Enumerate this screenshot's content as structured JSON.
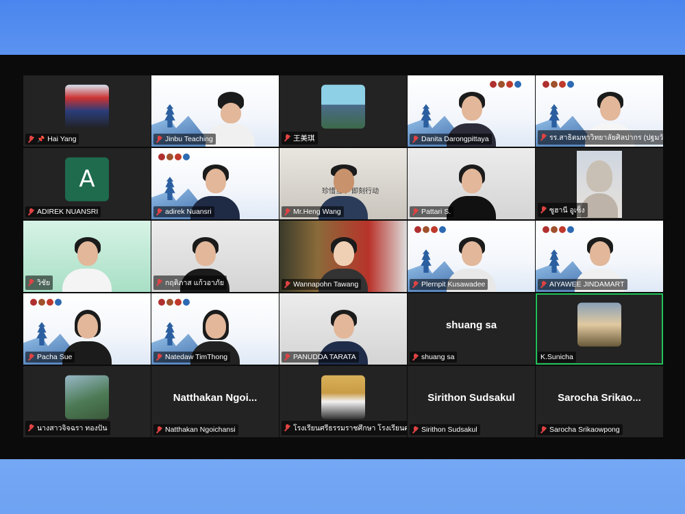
{
  "participants": [
    {
      "label": "Hai Yang",
      "muted": true,
      "pinned": true,
      "kind": "avatar"
    },
    {
      "label": "Jinbu Teaching",
      "muted": true,
      "kind": "slide"
    },
    {
      "label": "王美琪",
      "muted": true,
      "kind": "avatar"
    },
    {
      "label": "Danita Darongpittaya",
      "muted": true,
      "kind": "slide"
    },
    {
      "label": "รร.สาธิตมหาวิทยาลัยศิลปากร (ปฐมวัยและป...",
      "muted": true,
      "kind": "slide"
    },
    {
      "label": "ADIREK NUANSRI",
      "muted": true,
      "kind": "letter",
      "letter": "A"
    },
    {
      "label": "adirek Nuansri",
      "muted": true,
      "kind": "slide"
    },
    {
      "label": "Mr.Heng Wang",
      "muted": true,
      "kind": "video",
      "caption": "珍惜当下 即刻行动"
    },
    {
      "label": "Pattari S.",
      "muted": true,
      "kind": "video"
    },
    {
      "label": "ซูฮานี อูเซ็ง",
      "muted": true,
      "kind": "video"
    },
    {
      "label": "วิชัย",
      "muted": true,
      "kind": "video"
    },
    {
      "label": "กฤติภาส แก้วอาภัย",
      "muted": true,
      "kind": "video"
    },
    {
      "label": "Wannapohn Tawang",
      "muted": true,
      "kind": "video"
    },
    {
      "label": "Plernpit Kusawadee",
      "muted": true,
      "kind": "slide"
    },
    {
      "label": "AIYAWEE JINDAMART",
      "muted": true,
      "kind": "slide"
    },
    {
      "label": "Pacha Sue",
      "muted": true,
      "kind": "slide"
    },
    {
      "label": "Natedaw TimThong",
      "muted": true,
      "kind": "slide"
    },
    {
      "label": "PANUDDA TARATA",
      "muted": true,
      "kind": "video"
    },
    {
      "label": "shuang sa",
      "muted": true,
      "kind": "name",
      "big": "shuang sa"
    },
    {
      "label": "K.Sunicha",
      "muted": false,
      "kind": "avatar",
      "active": true
    },
    {
      "label": "นางสาวจิจฉรา ทองปัน",
      "muted": true,
      "kind": "avatar"
    },
    {
      "label": "Natthakan Ngoichansi",
      "muted": true,
      "kind": "name",
      "big": "Natthakan  Ngoi..."
    },
    {
      "label": "โรงเรียนศรีธรรมราชศึกษา โรงเรียนศรีธร...",
      "muted": true,
      "kind": "avatar"
    },
    {
      "label": "Sirithon Sudsakul",
      "muted": true,
      "kind": "name",
      "big": "Sirithon Sudsakul"
    },
    {
      "label": "Sarocha Srikaowpong",
      "muted": true,
      "kind": "name",
      "big": "Sarocha  Srikao..."
    }
  ],
  "colors": {
    "active_border": "#21c45a",
    "muted_icon": "#e04343",
    "letter_avatar_bg": "#1e6b4e"
  }
}
